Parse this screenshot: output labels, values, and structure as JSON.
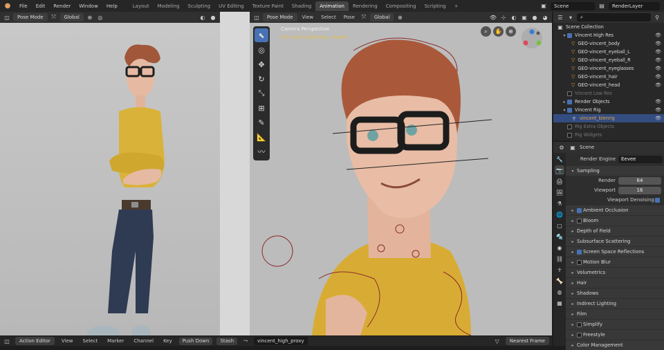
{
  "topbar": {
    "menus": [
      "File",
      "Edit",
      "Render",
      "Window",
      "Help"
    ],
    "tabs": [
      "Layout",
      "Modeling",
      "Sculpting",
      "UV Editing",
      "Texture Paint",
      "Shading",
      "Animation",
      "Rendering",
      "Compositing",
      "Scripting"
    ],
    "active_tab": "Animation",
    "scene": "Scene",
    "view_layer": "RenderLayer"
  },
  "left_viewport": {
    "mode": "Pose Mode",
    "orientation": "Global"
  },
  "right_viewport": {
    "mode": "Pose Mode",
    "menus": [
      "View",
      "Select",
      "Pose"
    ],
    "orientation": "Global",
    "label_camera": "Camera Perspective",
    "label_object": "(3) vincent_blenrig : mouth"
  },
  "outliner": {
    "title": "Scene Collection",
    "items": [
      {
        "name": "Vincent High Res"
      },
      {
        "name": "GEO-vincent_body"
      },
      {
        "name": "GEO-vincent_eyeball_L"
      },
      {
        "name": "GEO-vincent_eyeball_R"
      },
      {
        "name": "GEO-vincent_eyeglasses"
      },
      {
        "name": "GEO-vincent_hair"
      },
      {
        "name": "GEO-vincent_head"
      },
      {
        "name": "Vincent Low Res"
      },
      {
        "name": "Render Objects"
      },
      {
        "name": "Vincent Rig"
      },
      {
        "name": "vincent_blenrig"
      },
      {
        "name": "Rig Extra Objects"
      },
      {
        "name": "Rig Widgets"
      }
    ]
  },
  "properties": {
    "scene_name": "Scene",
    "render_engine_label": "Render Engine",
    "render_engine": "Eevee",
    "sampling": "Sampling",
    "render_label": "Render",
    "render_value": "64",
    "viewport_label": "Viewport",
    "viewport_value": "16",
    "denoise": "Viewport Denoising",
    "sections": [
      "Ambient Occlusion",
      "Bloom",
      "Depth of Field",
      "Subsurface Scattering",
      "Screen Space Reflections",
      "Motion Blur",
      "Volumetrics",
      "Hair",
      "Shadows",
      "Indirect Lighting",
      "Film",
      "Simplify",
      "Freestyle",
      "Color Management"
    ]
  },
  "bottombar": {
    "editor": "Action Editor",
    "menus": [
      "View",
      "Select",
      "Marker",
      "Channel",
      "Key"
    ],
    "push_down": "Push Down",
    "stash": "Stash",
    "action": "vincent_high_proxy",
    "interpolation": "Nearest Frame"
  }
}
